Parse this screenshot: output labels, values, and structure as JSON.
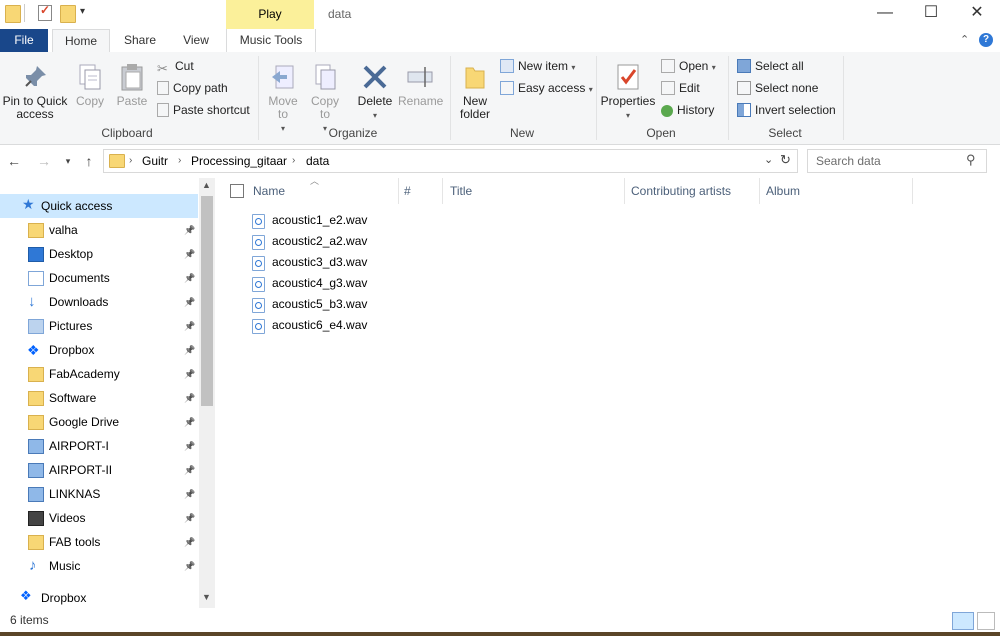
{
  "window": {
    "title": "data",
    "contextual_tab": "Play",
    "minimize_glyph": "—",
    "maximize_glyph": "☐",
    "close_glyph": "✕"
  },
  "tabs": [
    "File",
    "Home",
    "Share",
    "View",
    "Music Tools"
  ],
  "ribbon": {
    "clipboard": {
      "label": "Clipboard",
      "pin": "Pin to Quick access",
      "copy": "Copy",
      "paste": "Paste",
      "cut": "Cut",
      "copy_path": "Copy path",
      "paste_shortcut": "Paste shortcut"
    },
    "organize": {
      "label": "Organize",
      "move_to": "Move to",
      "copy_to": "Copy to",
      "delete": "Delete",
      "rename": "Rename"
    },
    "new": {
      "label": "New",
      "new_folder": "New folder",
      "new_item": "New item",
      "easy_access": "Easy access"
    },
    "open": {
      "label": "Open",
      "properties": "Properties",
      "open": "Open",
      "edit": "Edit",
      "history": "History"
    },
    "select": {
      "label": "Select",
      "select_all": "Select all",
      "select_none": "Select none",
      "invert": "Invert selection"
    }
  },
  "address": {
    "crumbs": [
      "Guitr",
      "Processing_gitaar",
      "data"
    ],
    "search_placeholder": "Search data"
  },
  "nav": {
    "quick_access": "Quick access",
    "items": [
      {
        "label": "valha",
        "icon": "folder-icon"
      },
      {
        "label": "Desktop",
        "icon": "desktop-icon"
      },
      {
        "label": "Documents",
        "icon": "documents-icon"
      },
      {
        "label": "Downloads",
        "icon": "downloads-icon"
      },
      {
        "label": "Pictures",
        "icon": "pictures-icon"
      },
      {
        "label": "Dropbox",
        "icon": "dropbox-icon"
      },
      {
        "label": "FabAcademy",
        "icon": "folder-icon"
      },
      {
        "label": "Software",
        "icon": "folder-icon"
      },
      {
        "label": "Google Drive",
        "icon": "folder-icon"
      },
      {
        "label": "AIRPORT-I",
        "icon": "network-drive-icon"
      },
      {
        "label": "AIRPORT-II",
        "icon": "network-drive-icon"
      },
      {
        "label": "LINKNAS",
        "icon": "network-drive-icon"
      },
      {
        "label": "Videos",
        "icon": "videos-icon"
      },
      {
        "label": "FAB tools",
        "icon": "folder-icon"
      },
      {
        "label": "Music",
        "icon": "music-icon"
      }
    ],
    "dropbox_root": "Dropbox"
  },
  "columns": [
    "Name",
    "#",
    "Title",
    "Contributing artists",
    "Album"
  ],
  "files": [
    "acoustic1_e2.wav",
    "acoustic2_a2.wav",
    "acoustic3_d3.wav",
    "acoustic4_g3.wav",
    "acoustic5_b3.wav",
    "acoustic6_e4.wav"
  ],
  "status": {
    "count": "6 items"
  },
  "colors": {
    "file_tab": "#19478a",
    "play_tab": "#fbf09a",
    "folder": "#f8d775",
    "accent_blue": "#2f78d6"
  }
}
